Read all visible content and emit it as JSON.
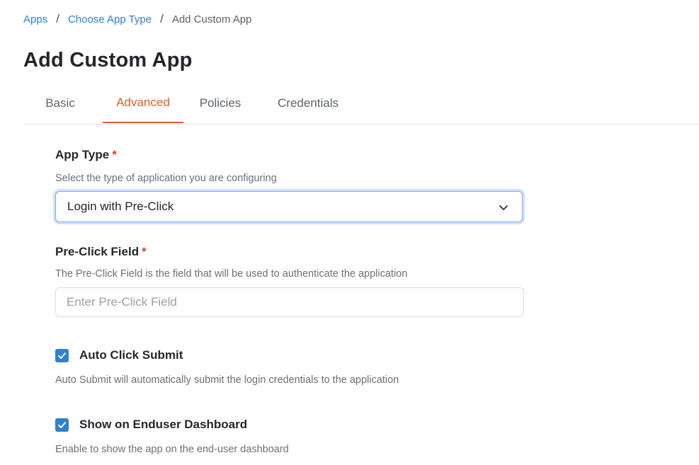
{
  "breadcrumb": {
    "items": [
      "Apps",
      "Choose App Type"
    ],
    "separator": "/",
    "current": "Add Custom App"
  },
  "page": {
    "title": "Add Custom App"
  },
  "tabs": [
    {
      "label": "Basic",
      "active": false
    },
    {
      "label": "Advanced",
      "active": true
    },
    {
      "label": "Policies",
      "active": false
    },
    {
      "label": "Credentials",
      "active": false
    }
  ],
  "form": {
    "app_type": {
      "label": "App Type",
      "required_mark": "*",
      "help": "Select the type of application you are configuring",
      "value": "Login with Pre-Click",
      "icon": "chevron-down-icon"
    },
    "pre_click_field": {
      "label": "Pre-Click Field",
      "required_mark": "*",
      "help": "The Pre-Click Field is the field that will be used to authenticate the application",
      "placeholder": "Enter Pre-Click Field",
      "value": ""
    },
    "auto_click_submit": {
      "label": "Auto Click Submit",
      "checked": true,
      "help": "Auto Submit will automatically submit the login credentials to the application"
    },
    "show_on_dashboard": {
      "label": "Show on Enduser Dashboard",
      "checked": true,
      "help": "Enable to show the app on the end-user dashboard"
    }
  },
  "colors": {
    "link": "#2f7fd1",
    "active_tab": "#d9612b",
    "required": "#d9412b",
    "checkbox": "#2f7fd1",
    "focus_ring": "#cfe2fa"
  }
}
